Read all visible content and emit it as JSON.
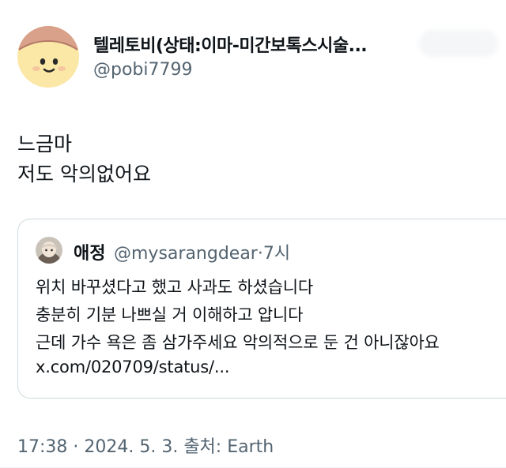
{
  "tweet": {
    "author": {
      "display_name": "텔레토비(상태:이마-미간보톡스시술...",
      "handle": "@pobi7799",
      "avatar_icon": "sun-face-avatar-icon"
    },
    "text_lines": [
      "느금마",
      "저도 악의없어요"
    ],
    "quote": {
      "author_name": "애정",
      "author_handle": "@mysarangdear",
      "separator": "·",
      "time": "7시",
      "lines": [
        "위치 바꾸셨다고 했고 사과도 하셨습니다",
        "충분히 기분 나쁘실 거 이해하고 압니다",
        "근데 가수 욕은 좀 삼가주세요 악의적으로 둔 건 아니잖아요"
      ],
      "link": "x.com/020709/status/..."
    },
    "meta": "17:38 · 2024. 5. 3. 출처: Earth"
  },
  "colors": {
    "text": "#0f1419",
    "secondary": "#536471",
    "border": "#cfd9de",
    "avatar_face": "#fbe7a6",
    "avatar_hair": "#d9a08a"
  }
}
